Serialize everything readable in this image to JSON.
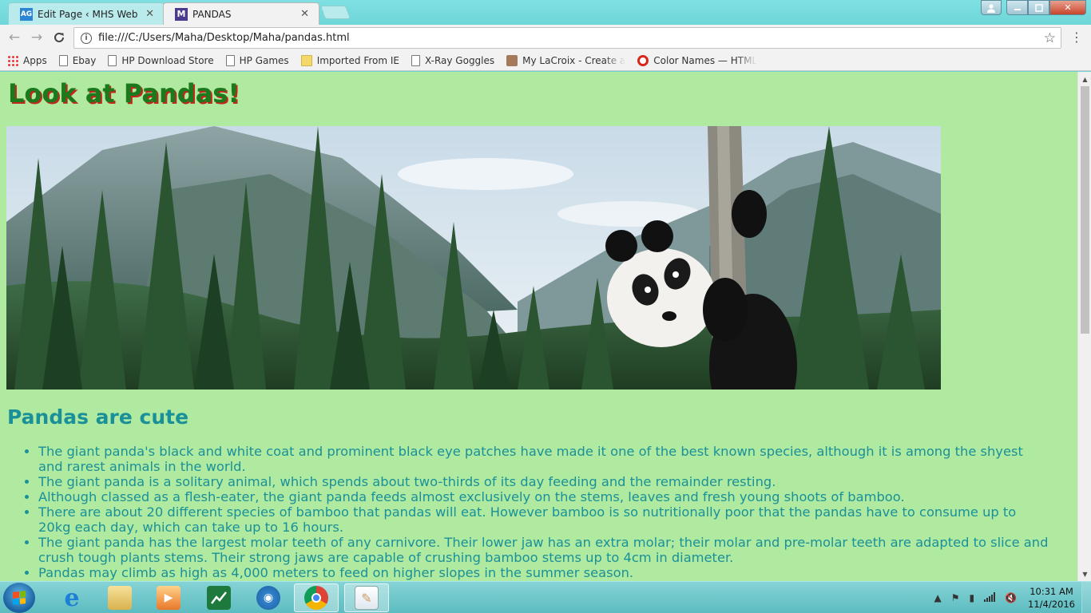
{
  "browser": {
    "tabs": [
      {
        "favicon": "AG",
        "title": "Edit Page ‹ MHS Web De",
        "active": false
      },
      {
        "favicon": "M",
        "title": "PANDAS",
        "active": true
      }
    ],
    "url": "file:///C:/Users/Maha/Desktop/Maha/pandas.html",
    "bookmarks": [
      {
        "icon": "apps-icon",
        "label": "Apps"
      },
      {
        "icon": "page-icon",
        "label": "Ebay"
      },
      {
        "icon": "page-icon",
        "label": "HP Download Store"
      },
      {
        "icon": "page-icon",
        "label": "HP Games"
      },
      {
        "icon": "folder-icon",
        "label": "Imported From IE"
      },
      {
        "icon": "page-icon",
        "label": "X-Ray Goggles"
      },
      {
        "icon": "lacroix-icon",
        "label": "My LaCroix - Create a"
      },
      {
        "icon": "opera-icon",
        "label": "Color Names — HTML"
      }
    ]
  },
  "page": {
    "title": "Look at Pandas!",
    "subheading": "Pandas are cute",
    "facts": [
      "The giant panda's black and white coat and prominent black eye patches have made it one of the best known species, although it is among the shyest and rarest animals in the world.",
      "The giant panda is a solitary animal, which spends about two-thirds of its day feeding and the remainder resting.",
      "Although classed as a flesh-eater, the giant panda feeds almost exclusively on the stems, leaves and fresh young shoots of bamboo.",
      "There are about 20 different species of bamboo that pandas will eat. However bamboo is so nutritionally poor that the pandas have to consume up to 20kg each day, which can take up to 16 hours.",
      "The giant panda has the largest molar teeth of any carnivore. Their lower jaw has an extra molar; their molar and pre-molar teeth are adapted to slice and crush tough plants stems. Their strong jaws are capable of crushing bamboo stems up to 4cm in diameter.",
      "Pandas may climb as high as 4,000 meters to feed on higher slopes in the summer season."
    ],
    "colors": {
      "background": "#b0eaa1",
      "title": "#1c7a1c",
      "title_shadow": "#c1271b",
      "text": "#1a9098"
    }
  },
  "taskbar": {
    "apps": [
      "internet-explorer-icon",
      "file-explorer-icon",
      "media-player-icon",
      "stock-app-icon",
      "wifi-app-icon",
      "chrome-icon",
      "notepad-icon"
    ],
    "clock_time": "10:31 AM",
    "clock_date": "11/4/2016"
  }
}
